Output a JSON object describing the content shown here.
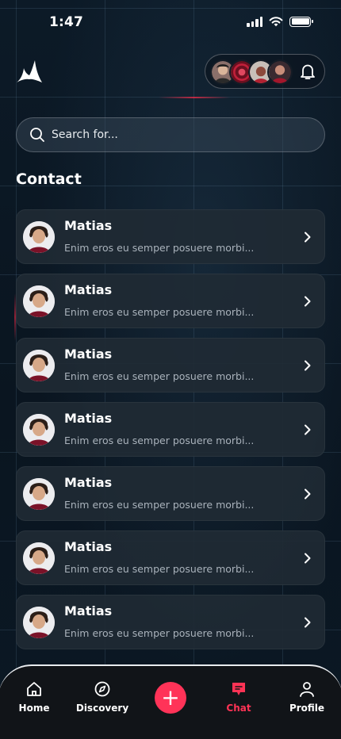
{
  "status_bar": {
    "time": "1:47"
  },
  "header": {
    "avatars": [
      "avatar-1",
      "avatar-2",
      "avatar-3",
      "avatar-4"
    ]
  },
  "search": {
    "placeholder": "Search for..."
  },
  "contacts_title": "Contact",
  "contacts": [
    {
      "name": "Matias",
      "message": "Enim eros eu semper posuere morbi..."
    },
    {
      "name": "Matias",
      "message": "Enim eros eu semper posuere morbi..."
    },
    {
      "name": "Matias",
      "message": "Enim eros eu semper posuere morbi..."
    },
    {
      "name": "Matias",
      "message": "Enim eros eu semper posuere morbi..."
    },
    {
      "name": "Matias",
      "message": "Enim eros eu semper posuere morbi..."
    },
    {
      "name": "Matias",
      "message": "Enim eros eu semper posuere morbi..."
    },
    {
      "name": "Matias",
      "message": "Enim eros eu semper posuere morbi..."
    }
  ],
  "nav": {
    "home": "Home",
    "discovery": "Discovery",
    "add": "+",
    "chat": "Chat",
    "profile": "Profile",
    "active": "chat"
  },
  "colors": {
    "accent": "#ff3358",
    "card": "#202a34",
    "background": "#0b1622"
  }
}
